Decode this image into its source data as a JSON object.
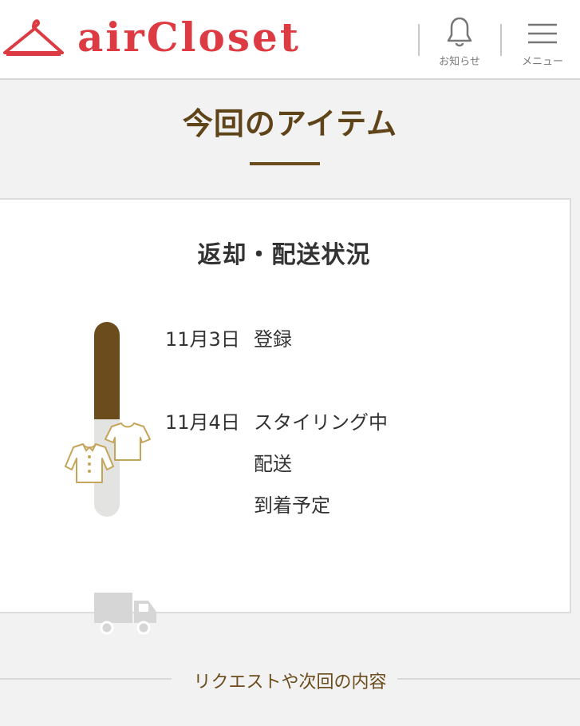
{
  "header": {
    "logo_text": "airCloset",
    "brand_color": "#dd3b43",
    "notifications_label": "お知らせ",
    "notifications_icon": "bell-icon",
    "menu_label": "メニュー",
    "menu_icon": "hamburger-menu-icon"
  },
  "page": {
    "title": "今回のアイテム",
    "accent_color": "#6b4c1c"
  },
  "status_card": {
    "title": "返却・配送状況",
    "progress_fraction": 0.5,
    "events": [
      {
        "date": "11月3日",
        "label": "登録"
      },
      {
        "date": "11月4日",
        "label": "スタイリング中"
      },
      {
        "date": "",
        "label": "配送"
      },
      {
        "date": "",
        "label": "到着予定"
      }
    ],
    "progress_icon": "clothes-icon",
    "shipping_icon": "truck-icon"
  },
  "next_section": {
    "label": "リクエストや次回の内容"
  }
}
